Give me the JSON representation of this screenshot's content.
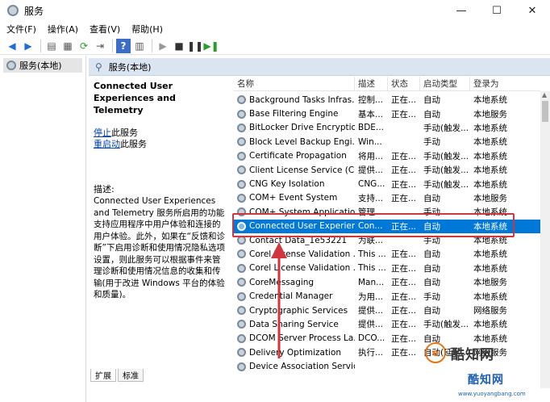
{
  "window": {
    "title": "服务",
    "controls": {
      "minimize": "—",
      "maximize": "☐",
      "close": "✕"
    }
  },
  "menu": [
    "文件(F)",
    "操作(A)",
    "查看(V)",
    "帮助(H)"
  ],
  "toolbar_icons": [
    "back-icon",
    "forward-icon",
    "console-tree-icon",
    "properties-icon",
    "refresh-icon",
    "export-icon",
    "help-icon",
    "show-hide-icon",
    "play-icon",
    "stop-icon",
    "pause-icon",
    "restart-icon"
  ],
  "tree": {
    "root_label": "服务(本地)"
  },
  "pane_header": "服务(本地)",
  "detail": {
    "service_title": "Connected User Experiences and Telemetry",
    "stop_link": "停止",
    "stop_suffix": "此服务",
    "restart_link": "重启动",
    "restart_suffix": "此服务",
    "desc_label": "描述:",
    "desc_text": "Connected User Experiences and Telemetry 服务所启用的功能支持应用程序中用户体验和连接的用户体验。此外，如果在“反馈和诊断”下启用诊断和使用情况隐私选项设置，则此服务可以根据事件来管理诊断和使用情况信息的收集和传输(用于改进 Windows 平台的体验和质量)。"
  },
  "columns": {
    "name": "名称",
    "desc": "描述",
    "status": "状态",
    "startup": "启动类型",
    "logon": "登录为"
  },
  "services": [
    {
      "name": "Background Tasks Infras...",
      "desc": "控制...",
      "status": "正在...",
      "startup": "自动",
      "logon": "本地系统"
    },
    {
      "name": "Base Filtering Engine",
      "desc": "基本...",
      "status": "正在...",
      "startup": "自动",
      "logon": "本地服务"
    },
    {
      "name": "BitLocker Drive Encryptio...",
      "desc": "BDE...",
      "status": "",
      "startup": "手动(触发...",
      "logon": "本地系统"
    },
    {
      "name": "Block Level Backup Engi...",
      "desc": "Win...",
      "status": "",
      "startup": "手动",
      "logon": "本地系统"
    },
    {
      "name": "Certificate Propagation",
      "desc": "将用...",
      "status": "正在...",
      "startup": "手动(触发...",
      "logon": "本地系统"
    },
    {
      "name": "Client License Service (Cli...",
      "desc": "提供...",
      "status": "正在...",
      "startup": "手动(触发...",
      "logon": "本地系统"
    },
    {
      "name": "CNG Key Isolation",
      "desc": "CNG...",
      "status": "正在...",
      "startup": "手动(触发...",
      "logon": "本地系统"
    },
    {
      "name": "COM+ Event System",
      "desc": "支持...",
      "status": "正在...",
      "startup": "自动",
      "logon": "本地服务"
    },
    {
      "name": "COM+ System Application",
      "desc": "管理...",
      "status": "",
      "startup": "手动",
      "logon": "本地系统"
    },
    {
      "name": "Connected User Experien...",
      "desc": "Con...",
      "status": "正在...",
      "startup": "自动",
      "logon": "本地系统",
      "selected": true
    },
    {
      "name": "Contact Data_1e53221",
      "desc": "为联...",
      "status": "",
      "startup": "手动",
      "logon": "本地系统"
    },
    {
      "name": "Corel License Validation ...",
      "desc": "This ...",
      "status": "正在...",
      "startup": "自动",
      "logon": "本地系统"
    },
    {
      "name": "Corel License Validation ...",
      "desc": "This ...",
      "status": "正在...",
      "startup": "自动",
      "logon": "本地系统"
    },
    {
      "name": "CoreMessaging",
      "desc": "Man...",
      "status": "正在...",
      "startup": "自动",
      "logon": "本地服务"
    },
    {
      "name": "Credential Manager",
      "desc": "为用...",
      "status": "正在...",
      "startup": "手动",
      "logon": "本地系统"
    },
    {
      "name": "Cryptographic Services",
      "desc": "提供...",
      "status": "正在...",
      "startup": "自动",
      "logon": "网络服务"
    },
    {
      "name": "Data Sharing Service",
      "desc": "提供...",
      "status": "正在...",
      "startup": "手动(触发...",
      "logon": "本地系统"
    },
    {
      "name": "DCOM Server Process La...",
      "desc": "DCO...",
      "status": "正在...",
      "startup": "自动",
      "logon": "本地系统"
    },
    {
      "name": "Delivery Optimization",
      "desc": "执行...",
      "status": "正在...",
      "startup": "自动(延迟...",
      "logon": "网络服务"
    },
    {
      "name": "Device Association Servic...",
      "desc": "",
      "status": "",
      "startup": "",
      "logon": ""
    }
  ],
  "tabs": [
    "扩展",
    "标准"
  ],
  "watermark": {
    "brand": "酷知网",
    "brand2": "酷知网",
    "url": "www.yuoyangbang.com"
  },
  "colors": {
    "selection": "#0078d7",
    "highlight_box": "#d0363d",
    "header_bg": "#dbe5f1"
  }
}
